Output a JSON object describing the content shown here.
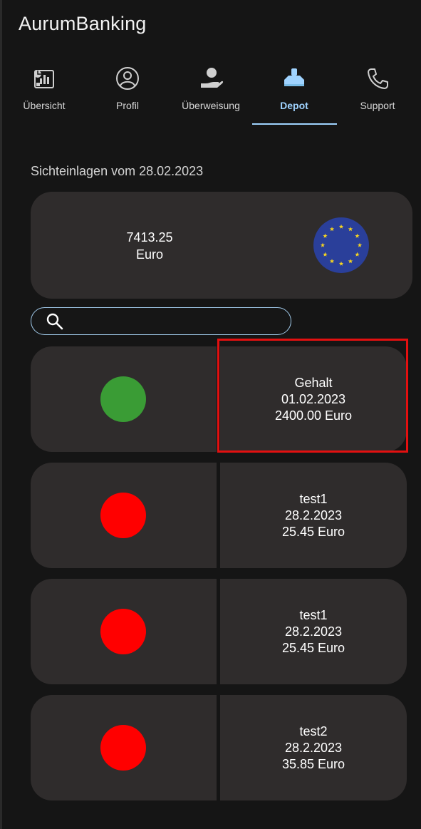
{
  "app": {
    "title": "AurumBanking"
  },
  "tabs": [
    {
      "label": "Übersicht",
      "icon": "overview-chart-icon",
      "active": false
    },
    {
      "label": "Profil",
      "icon": "profile-icon",
      "active": false
    },
    {
      "label": "Überweisung",
      "icon": "transfer-hand-icon",
      "active": false
    },
    {
      "label": "Depot",
      "icon": "depot-icon",
      "active": true
    },
    {
      "label": "Support",
      "icon": "phone-icon",
      "active": false
    }
  ],
  "depot": {
    "section_label": "Sichteinlagen vom 28.02.2023",
    "balance": {
      "amount": "7413.25",
      "currency": "Euro",
      "flag_icon": "eu-flag-icon"
    },
    "search": {
      "placeholder": "",
      "value": ""
    },
    "transactions": [
      {
        "title": "Gehalt",
        "date": "01.02.2023",
        "amount": "2400.00 Euro",
        "status": "income",
        "color": "#3a9c35"
      },
      {
        "title": "test1",
        "date": "28.2.2023",
        "amount": "25.45 Euro",
        "status": "expense",
        "color": "#ff0000"
      },
      {
        "title": "test1",
        "date": "28.2.2023",
        "amount": "25.45 Euro",
        "status": "expense",
        "color": "#ff0000"
      },
      {
        "title": "test2",
        "date": "28.2.2023",
        "amount": "35.85 Euro",
        "status": "expense",
        "color": "#ff0000"
      }
    ]
  },
  "colors": {
    "background": "#151515",
    "card": "#2f2c2c",
    "accent": "#9fd3ff",
    "income": "#3a9c35",
    "expense": "#ff0000",
    "highlight": "#e31010"
  }
}
